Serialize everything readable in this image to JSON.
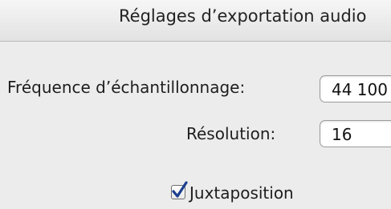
{
  "dialog": {
    "title": "Réglages d’exportation audio"
  },
  "settings": {
    "sample_rate": {
      "label": "Fréquence d’échantillonnage:",
      "value": "44 100"
    },
    "resolution": {
      "label": "Résolution:",
      "value": "16"
    },
    "dither": {
      "label": "Juxtaposition",
      "checked": true
    }
  }
}
